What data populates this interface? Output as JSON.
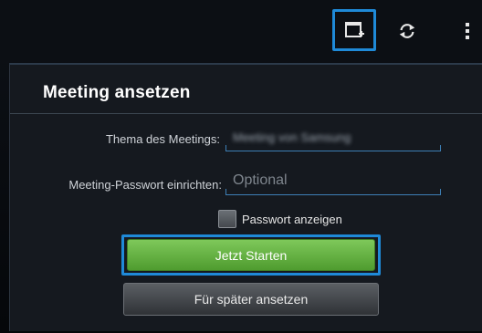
{
  "actionbar": {
    "icons": [
      "new-window-icon",
      "refresh-icon",
      "overflow-menu-icon"
    ],
    "highlight_color": "#1f8ad8"
  },
  "dialog": {
    "title": "Meeting ansetzen",
    "topic_label": "Thema des Meetings:",
    "topic_value": "Meeting von Samsung",
    "password_label": "Meeting-Passwort einrichten:",
    "password_placeholder": "Optional",
    "show_password_label": "Passwort anzeigen",
    "start_button": "Jetzt Starten",
    "later_button": "Für später ansetzen"
  },
  "colors": {
    "start_button": "#5fae3c",
    "accent": "#1f8ad8"
  }
}
